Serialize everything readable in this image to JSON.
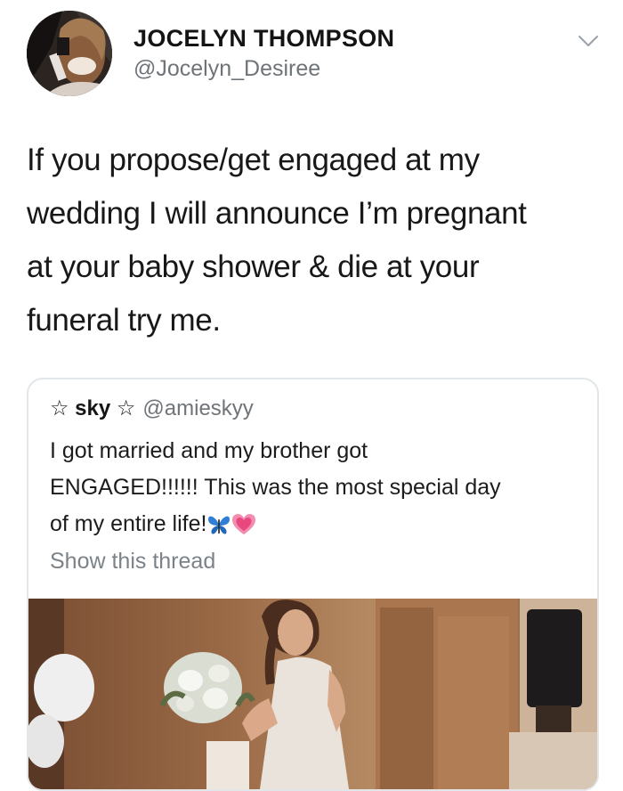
{
  "user": {
    "display_name": "JOCELYN THOMPSON",
    "handle": "@Jocelyn_Desiree",
    "avatar_icon": "profile-photo",
    "menu_icon": "chevron-down-icon"
  },
  "tweet": {
    "lines": [
      "If you propose/get engaged at my",
      "wedding I will announce I’m pregnant",
      "at your baby shower & die at your",
      "funeral try me."
    ]
  },
  "quoted_tweet": {
    "name": "☆ sky ☆",
    "handle": "@amieskyy",
    "lines": [
      "I got married and my brother got",
      "ENGAGED!!!!!! This was the most special day",
      "of my entire life!"
    ],
    "emojis": [
      "butterfly-emoji",
      "growing-heart-emoji"
    ],
    "show_thread": "Show this thread",
    "media_icon": "wedding-video-thumbnail"
  },
  "colors": {
    "text_primary": "#141414",
    "text_secondary": "#6f7479",
    "border": "#e2e6e9",
    "butterfly": "#2f7fd6",
    "heart": "#f0679a"
  }
}
